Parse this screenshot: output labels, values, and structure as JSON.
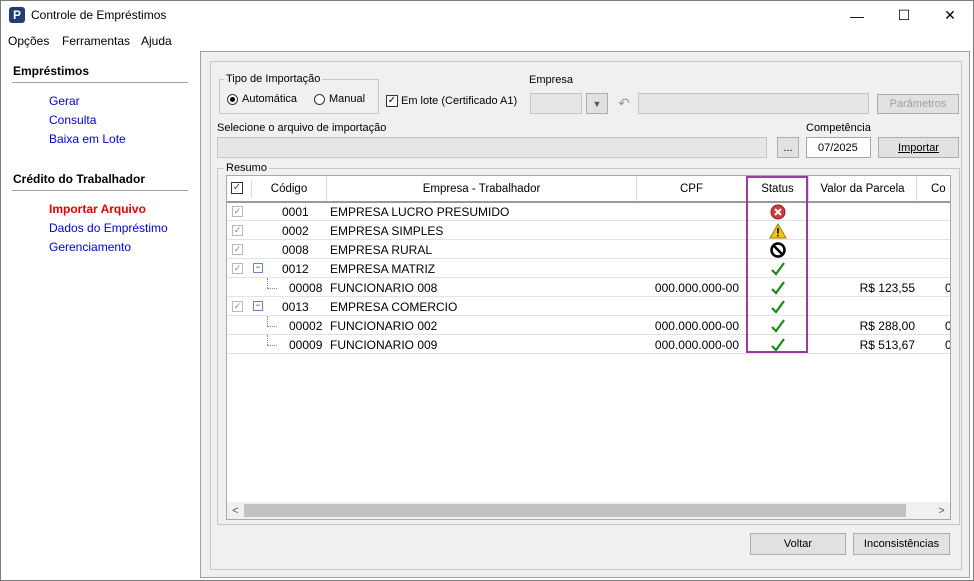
{
  "window": {
    "title": "Controle de Empréstimos",
    "app_icon_letter": "P",
    "minimize_glyph": "—",
    "maximize_glyph": "☐",
    "close_glyph": "✕"
  },
  "menu": [
    "Opções",
    "Ferramentas",
    "Ajuda"
  ],
  "sidebar": {
    "sections": [
      {
        "title": "Empréstimos",
        "items": [
          {
            "label": "Gerar",
            "active": false
          },
          {
            "label": "Consulta",
            "active": false
          },
          {
            "label": "Baixa em Lote",
            "active": false
          }
        ]
      },
      {
        "title": "Crédito do Trabalhador",
        "items": [
          {
            "label": "Importar Arquivo",
            "active": true
          },
          {
            "label": "Dados do Empréstimo",
            "active": false
          },
          {
            "label": "Gerenciamento",
            "active": false
          }
        ]
      }
    ]
  },
  "import": {
    "type_group_title": "Tipo de Importação",
    "radio_auto": "Automática",
    "radio_manual": "Manual",
    "selected": "Automática",
    "batch_label": "Em lote (Certificado A1)",
    "batch_checked": true,
    "company_label": "Empresa",
    "company_code": "",
    "company_name": "",
    "params_button": "Parâmetros",
    "file_label": "Selecione o arquivo de importação",
    "file_path": "",
    "browse_button": "...",
    "competencia_label": "Competência",
    "competencia_value": "07/2025",
    "import_button": "Importar"
  },
  "summary": {
    "group_title": "Resumo",
    "columns": [
      "Código",
      "Empresa - Trabalhador",
      "CPF",
      "Status",
      "Valor da Parcela",
      "Co"
    ],
    "rows": [
      {
        "code": "0001",
        "name": "EMPRESA LUCRO PRESUMIDO",
        "cpf": "",
        "status": "error-icon",
        "valor": "",
        "co": "",
        "level": 0,
        "expander": ""
      },
      {
        "code": "0002",
        "name": "EMPRESA SIMPLES",
        "cpf": "",
        "status": "warning-icon",
        "valor": "",
        "co": "",
        "level": 0,
        "expander": ""
      },
      {
        "code": "0008",
        "name": "EMPRESA RURAL",
        "cpf": "",
        "status": "blocked-icon",
        "valor": "",
        "co": "",
        "level": 0,
        "expander": ""
      },
      {
        "code": "0012",
        "name": "EMPRESA MATRIZ",
        "cpf": "",
        "status": "check-icon",
        "valor": "",
        "co": "",
        "level": 0,
        "expander": "−"
      },
      {
        "code": "00008",
        "name": "FUNCIONARIO 008",
        "cpf": "000.000.000-00",
        "status": "check-icon",
        "valor": "R$ 123,55",
        "co": "0",
        "level": 1,
        "expander": ""
      },
      {
        "code": "0013",
        "name": "EMPRESA COMERCIO",
        "cpf": "",
        "status": "check-icon",
        "valor": "",
        "co": "",
        "level": 0,
        "expander": "−"
      },
      {
        "code": "00002",
        "name": "FUNCIONARIO 002",
        "cpf": "000.000.000-00",
        "status": "check-icon",
        "valor": "R$ 288,00",
        "co": "0",
        "level": 1,
        "expander": ""
      },
      {
        "code": "00009",
        "name": "FUNCIONARIO 009",
        "cpf": "000.000.000-00",
        "status": "check-icon",
        "valor": "R$ 513,67",
        "co": "0",
        "level": 1,
        "expander": ""
      }
    ]
  },
  "footer": {
    "back_button": "Voltar",
    "inconsistencies_button": "Inconsistências"
  },
  "colors": {
    "highlight": "#9b3c9c",
    "link": "#0000e0",
    "active_link": "#e00000",
    "ok": "#1a8a1a"
  }
}
